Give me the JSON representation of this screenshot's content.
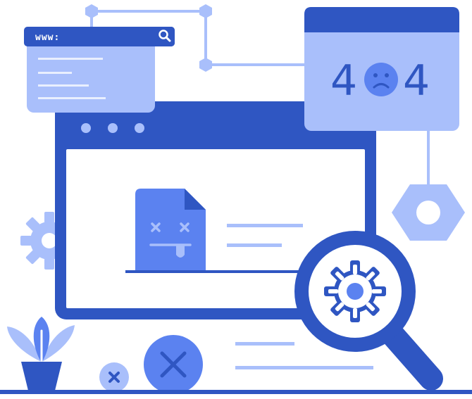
{
  "browser_mini": {
    "url_text": "www:"
  },
  "error_card": {
    "digit_left": "4",
    "digit_right": "4"
  },
  "icons": {
    "search": "search-icon",
    "sad_face": "sad-face-icon",
    "broken_file": "broken-file-icon",
    "gear": "gear-icon",
    "magnifier": "magnifier-icon",
    "close": "close-icon",
    "plant": "plant-icon",
    "hex_nut": "hex-nut-icon"
  },
  "colors": {
    "primary": "#2f56c2",
    "mid": "#5b82f0",
    "light": "#a9bffb",
    "white": "#ffffff"
  }
}
